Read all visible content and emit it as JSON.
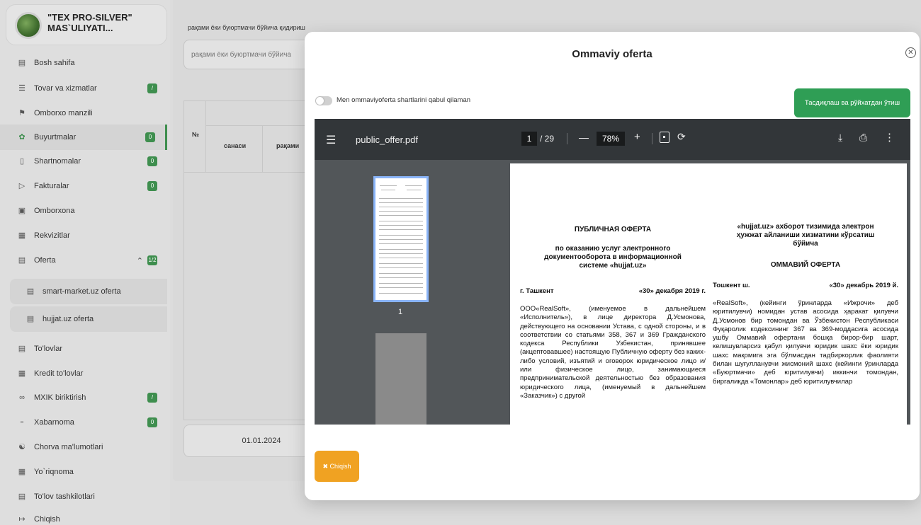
{
  "company": {
    "name": "\"TEX PRO-SILVER\" MAS`ULIYATI..."
  },
  "sidebar": {
    "items": [
      {
        "label": "Bosh sahifa",
        "icon": "home-icon"
      },
      {
        "label": "Tovar va xizmatlar",
        "icon": "barcode-icon",
        "badge": "/"
      },
      {
        "label": "Omborxo manzili",
        "icon": "warehouse-address-icon"
      },
      {
        "label": "Buyurtmalar",
        "icon": "leaf-icon",
        "badge": "0"
      },
      {
        "label": "Shartnomalar",
        "icon": "contract-icon",
        "badge": "0"
      },
      {
        "label": "Fakturalar",
        "icon": "invoice-icon",
        "badge": "0"
      },
      {
        "label": "Omborxona",
        "icon": "warehouse-icon"
      },
      {
        "label": "Rekvizitlar",
        "icon": "requisites-icon"
      },
      {
        "label": "Oferta",
        "icon": "offer-icon",
        "badge": "1/2"
      },
      {
        "label": "smart-market.uz oferta",
        "icon": "document-icon"
      },
      {
        "label": "hujjat.uz oferta",
        "icon": "document-icon"
      },
      {
        "label": "To'lovlar",
        "icon": "payment-icon"
      },
      {
        "label": "Kredit to'lovlar",
        "icon": "credit-icon"
      },
      {
        "label": "MXIK biriktirish",
        "icon": "link-icon",
        "badge": "/"
      },
      {
        "label": "Xabarnoma",
        "icon": "message-icon",
        "badge": "0"
      },
      {
        "label": "Chorva ma'lumotlari",
        "icon": "livestock-icon"
      },
      {
        "label": "Yo`riqnoma",
        "icon": "guide-icon"
      },
      {
        "label": "To'lov tashkilotlari",
        "icon": "bank-icon"
      },
      {
        "label": "Chiqish",
        "icon": "logout-icon"
      }
    ]
  },
  "background": {
    "search_label": "рақами ёки буюртмачи бўйича қидириш",
    "search_placeholder": "рақами ёки буюртмачи бўйича",
    "table_headers": {
      "no": "№",
      "date": "санаси",
      "number": "рақами"
    },
    "date_value": "01.01.2024"
  },
  "modal": {
    "title": "Ommaviy oferta",
    "toggle_label": "Men ommaviyoferta shartlarini qabul qilaman",
    "confirm_button": "Тасдиқлаш ва рўйхатдан ўтиш",
    "exit_button": "✖ Chiqish"
  },
  "pdf": {
    "file_name": "public_offer.pdf",
    "current_page": "1",
    "total_pages": "/ 29",
    "zoom": "78%",
    "thumbnail_label": "1",
    "left_column": {
      "title": "ПУБЛИЧНАЯ ОФЕРТА",
      "subtitle": "по оказанию услуг электронного документооборота в информационной системе «hujjat.uz»",
      "city": "г. Ташкент",
      "date": "«30» декабря 2019 г.",
      "body": "ООО«RealSoft», (именуемое в дальнейшем «Исполнитель»), в лице директора Д.Усмонова, действующего на основании Устава, с одной стороны, и в соответствии со статьями 358, 367 и 369 Гражданского кодекса Республики Узбекистан, принявшее (акцептовавшее) настоящую Публичную оферту без каких-либо условий, изъятий и оговорок юридическое лицо и/или физическое лицо, занимающиеся предпринимательской деятельностью без образования юридического лица, (именуемый в дальнейшем «Заказчик») с другой"
    },
    "right_column": {
      "subtitle": "«hujjat.uz» ахборот тизимида электрон ҳужжат айланиши хизматини кўрсатиш бўйича",
      "title": "ОММАВИЙ ОФЕРТА",
      "city": "Тошкент ш.",
      "date": "«30» декабрь 2019 й.",
      "body": "«RealSoft», (кейинги ўринларда «Ижрочи» деб юритилувчи) номидан устав асосида ҳаракат қилувчи Д.Усмонов бир томондан ва Ўзбекистон Республикаси Фуқаролик кодексининг 367 ва 369-моддасига асосида ушбу Оммавий офертани бошқа бирор-бир шарт, келишувларсиз қабул қилувчи юридик шахс ёки юридик шахс мақомига эга бўлмасдан тадбиркорлик фаолияти билан шуғулланувчи жисмоний шахс (кейинги ўринларда «Буюртмачи» деб юритилувчи) иккинчи томондан, биргаликда «Томонлар» деб юритилувчилар"
    }
  },
  "colors": {
    "accent_green": "#2f9e55",
    "exit_orange": "#f0a222",
    "pdf_toolbar": "#323639"
  }
}
